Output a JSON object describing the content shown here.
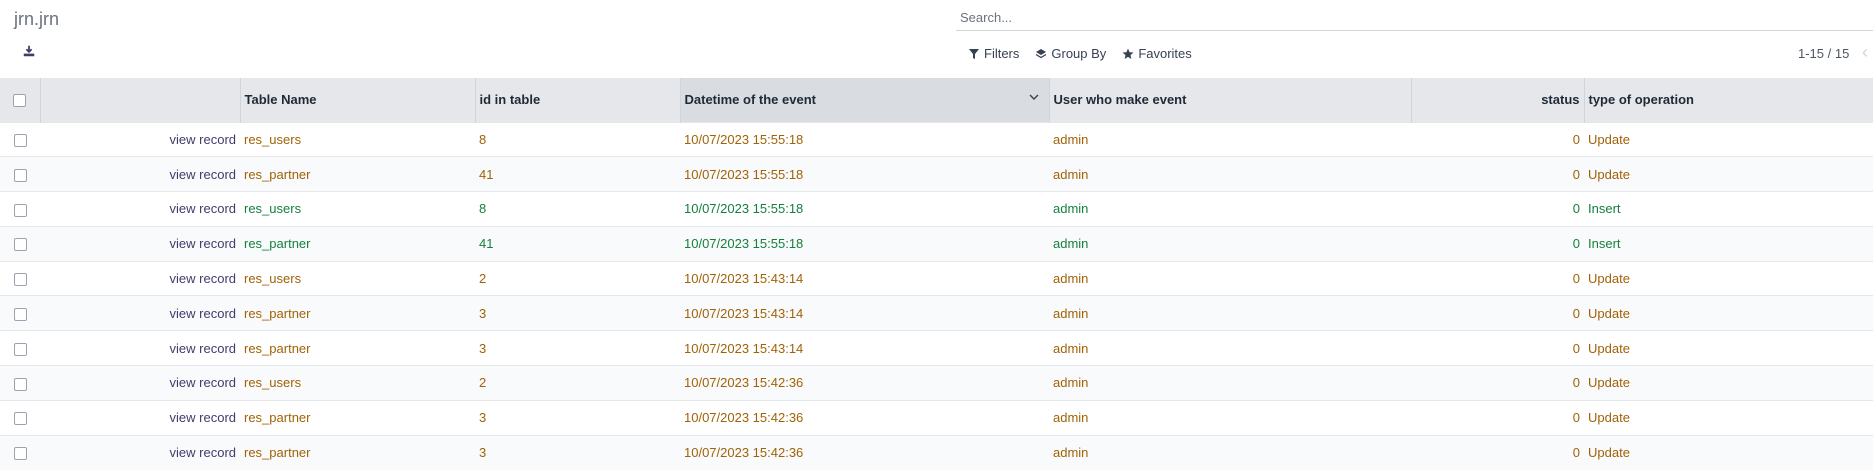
{
  "header": {
    "title": "jrn.jrn",
    "search_placeholder": "Search...",
    "filters_label": "Filters",
    "groupby_label": "Group By",
    "favorites_label": "Favorites",
    "pager": "1-15 / 15"
  },
  "columns": {
    "button": "",
    "table_name": "Table Name",
    "id_in_table": "id in table",
    "datetime": "Datetime of the event",
    "user": "User who make event",
    "status": "status",
    "type": "type of operation"
  },
  "colors": {
    "update": "#a16207",
    "insert": "#15803d",
    "header_bg": "#e5e7eb"
  },
  "rows": [
    {
      "button": "view record",
      "table_name": "res_users",
      "id": "8",
      "datetime": "10/07/2023 15:55:18",
      "user": "admin",
      "status": "0",
      "type": "Update"
    },
    {
      "button": "view record",
      "table_name": "res_partner",
      "id": "41",
      "datetime": "10/07/2023 15:55:18",
      "user": "admin",
      "status": "0",
      "type": "Update"
    },
    {
      "button": "view record",
      "table_name": "res_users",
      "id": "8",
      "datetime": "10/07/2023 15:55:18",
      "user": "admin",
      "status": "0",
      "type": "Insert"
    },
    {
      "button": "view record",
      "table_name": "res_partner",
      "id": "41",
      "datetime": "10/07/2023 15:55:18",
      "user": "admin",
      "status": "0",
      "type": "Insert"
    },
    {
      "button": "view record",
      "table_name": "res_users",
      "id": "2",
      "datetime": "10/07/2023 15:43:14",
      "user": "admin",
      "status": "0",
      "type": "Update"
    },
    {
      "button": "view record",
      "table_name": "res_partner",
      "id": "3",
      "datetime": "10/07/2023 15:43:14",
      "user": "admin",
      "status": "0",
      "type": "Update"
    },
    {
      "button": "view record",
      "table_name": "res_partner",
      "id": "3",
      "datetime": "10/07/2023 15:43:14",
      "user": "admin",
      "status": "0",
      "type": "Update"
    },
    {
      "button": "view record",
      "table_name": "res_users",
      "id": "2",
      "datetime": "10/07/2023 15:42:36",
      "user": "admin",
      "status": "0",
      "type": "Update"
    },
    {
      "button": "view record",
      "table_name": "res_partner",
      "id": "3",
      "datetime": "10/07/2023 15:42:36",
      "user": "admin",
      "status": "0",
      "type": "Update"
    },
    {
      "button": "view record",
      "table_name": "res_partner",
      "id": "3",
      "datetime": "10/07/2023 15:42:36",
      "user": "admin",
      "status": "0",
      "type": "Update"
    }
  ]
}
